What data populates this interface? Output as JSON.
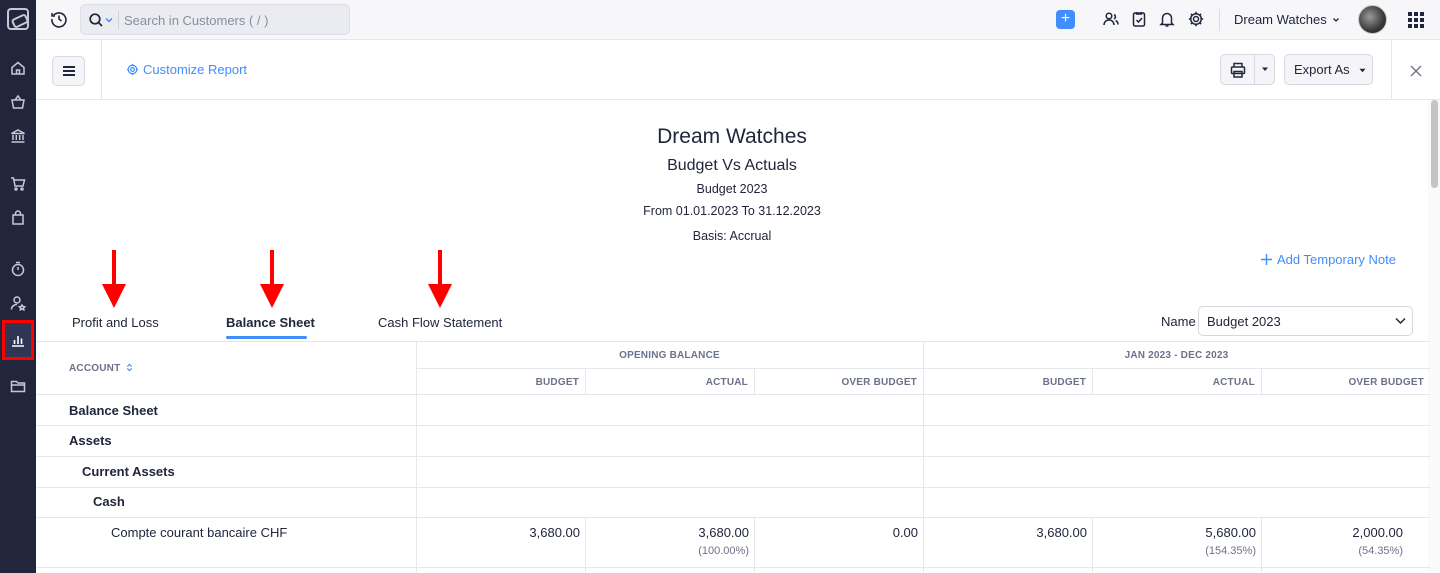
{
  "topbar": {
    "search_placeholder": "Search in Customers ( / )",
    "org_name": "Dream Watches"
  },
  "report_header": {
    "customize_label": "Customize Report",
    "export_label": "Export As"
  },
  "report": {
    "org": "Dream Watches",
    "title": "Budget Vs Actuals",
    "budget": "Budget 2023",
    "period": "From 01.01.2023 To 31.12.2023",
    "basis": "Basis: Accrual",
    "add_note": "Add Temporary Note"
  },
  "tabs": [
    {
      "label": "Profit and Loss"
    },
    {
      "label": "Balance Sheet"
    },
    {
      "label": "Cash Flow Statement"
    }
  ],
  "name_filter": {
    "label": "Name",
    "value": "Budget 2023"
  },
  "table": {
    "account_header": "ACCOUNT",
    "groups": [
      "OPENING BALANCE",
      "JAN 2023 - DEC 2023"
    ],
    "subcolumns": [
      "BUDGET",
      "ACTUAL",
      "OVER BUDGET",
      "BUDGET",
      "ACTUAL",
      "OVER BUDGET"
    ],
    "rows": [
      {
        "label": "Balance Sheet"
      },
      {
        "label": "Assets"
      },
      {
        "label": "Current Assets"
      },
      {
        "label": "Cash"
      },
      {
        "label": "Compte courant bancaire CHF",
        "values": [
          "3,680.00",
          "3,680.00",
          "0.00",
          "3,680.00",
          "5,680.00",
          "2,000.00"
        ],
        "pcts": [
          "",
          "(100.00%)",
          "",
          "",
          "(154.35%)",
          "(54.35%)"
        ]
      }
    ]
  }
}
